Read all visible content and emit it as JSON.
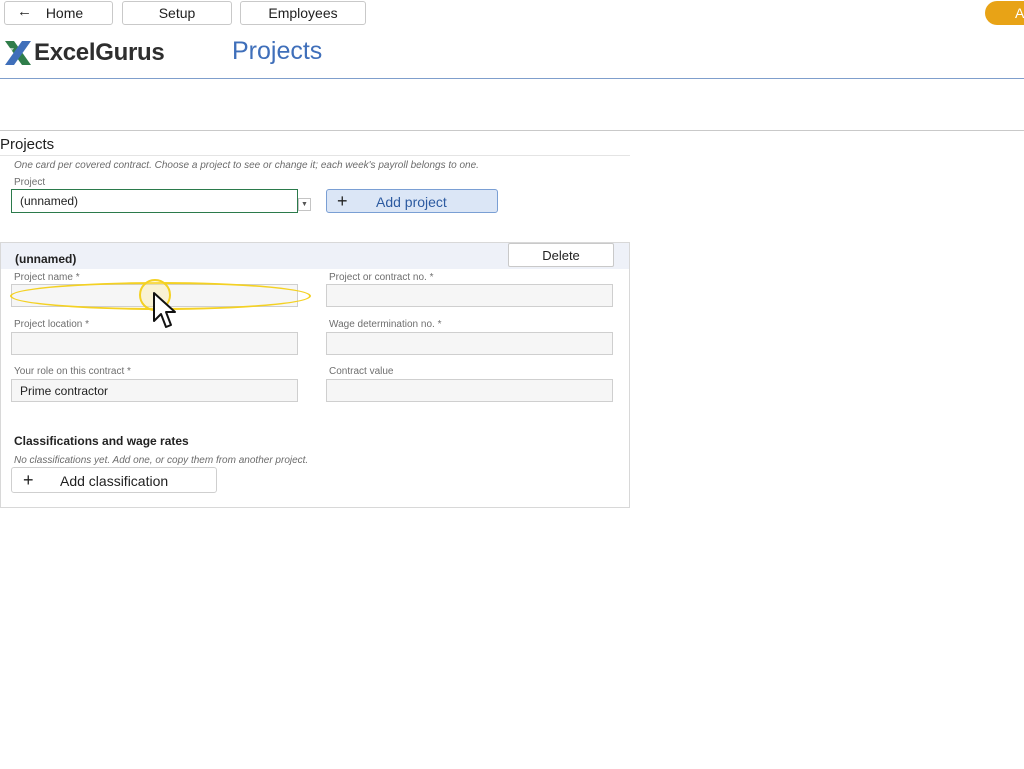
{
  "nav": {
    "home_label": "Home",
    "back_arrow": "←",
    "setup_label": "Setup",
    "employees_label": "Employees",
    "pill_text": "A"
  },
  "brand": {
    "logo_text": "ExcelGurus",
    "logo_colors": [
      "#2f7d4a",
      "#3f6fba"
    ],
    "page_title": "Projects",
    "accent": "#3f6fba"
  },
  "projects_section": {
    "title": "Projects",
    "hint": "One card per covered contract. Choose a project to see or change it; each week's payroll belongs to one.",
    "project_label": "Project",
    "selected_project": "(unnamed)",
    "dropdown_icon": "chevron-down-icon",
    "add_project_plus": "+",
    "add_project_label": "Add project"
  },
  "card": {
    "name": "(unnamed)",
    "delete_label": "Delete",
    "fields": {
      "project_name": {
        "label": "Project name *",
        "value": ""
      },
      "contract_no": {
        "label": "Project or contract no. *",
        "value": ""
      },
      "location": {
        "label": "Project location *",
        "value": ""
      },
      "wage_det": {
        "label": "Wage determination no. *",
        "value": ""
      },
      "role": {
        "label": "Your role on this contract *",
        "value": "Prime contractor"
      },
      "contract_value": {
        "label": "Contract value",
        "value": ""
      }
    },
    "classifications_title": "Classifications and wage rates",
    "classifications_hint": "No classifications yet. Add one, or copy them from another project.",
    "add_class_plus": "+",
    "add_class_label": "Add classification"
  },
  "overlay": {
    "highlight_color": "#f4d123",
    "cursor_icon": "arrow-cursor-icon"
  }
}
